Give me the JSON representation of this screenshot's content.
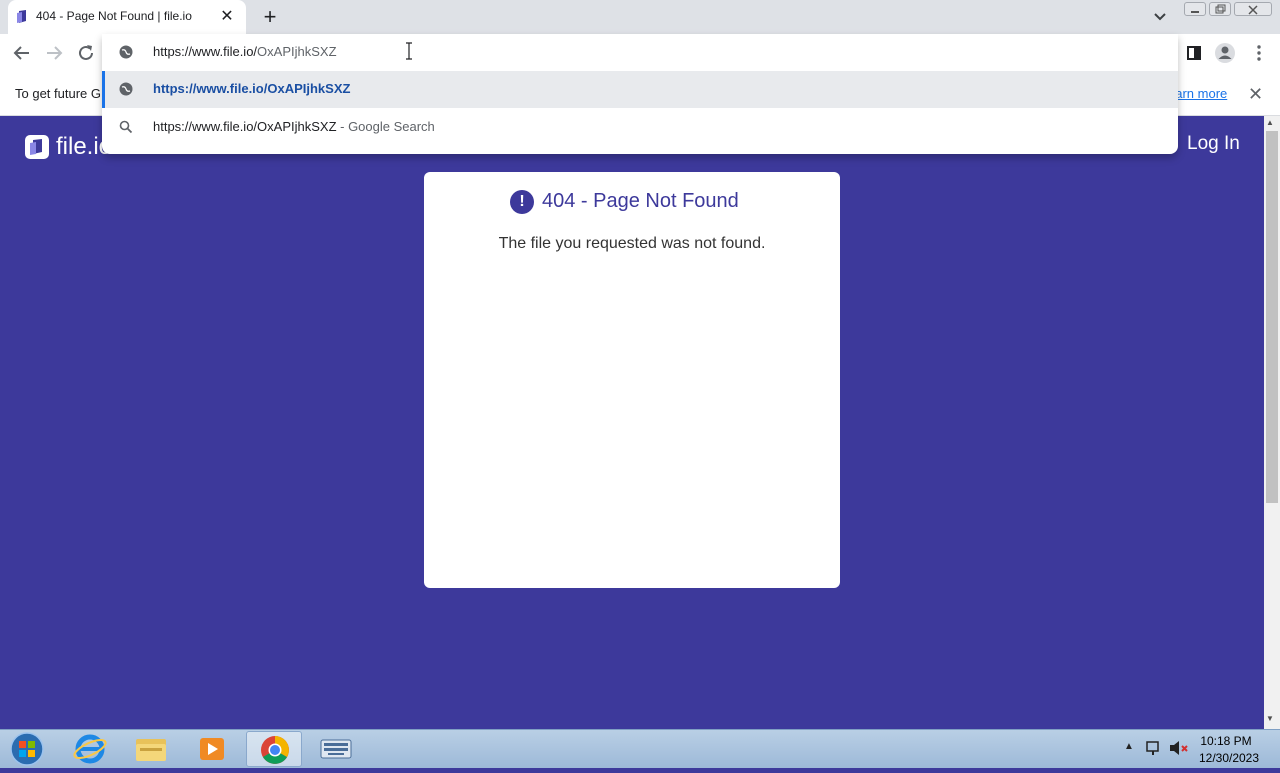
{
  "browser": {
    "tab_title": "404 - Page Not Found | file.io",
    "tab_close": "✕",
    "new_tab": "+",
    "omnibox_text_prefix": "https://www.file.io/",
    "omnibox_text_path": "OxAPIjhkSXZ",
    "suggestion_1": "https://www.file.io/OxAPIjhkSXZ",
    "suggestion_2_query": "https://www.file.io/OxAPIjhkSXZ",
    "suggestion_2_suffix": " - Google Search"
  },
  "infobar": {
    "text": "To get future G",
    "link": "earn more",
    "close": "✕"
  },
  "site": {
    "logo_text": "file.io",
    "login": "Log In"
  },
  "card": {
    "icon": "!",
    "title": "404 - Page Not Found",
    "message": "The file you requested was not found."
  },
  "taskbar": {
    "time": "10:18 PM",
    "date": "12/30/2023",
    "apps": [
      "start-orb",
      "internet-explorer-icon",
      "file-explorer-icon",
      "media-player-icon",
      "chrome-icon",
      "keyboard-app-icon"
    ]
  },
  "colors": {
    "brand": "#3d399b",
    "link": "#1a73e8",
    "suggestion_bg": "#e8eaed"
  }
}
